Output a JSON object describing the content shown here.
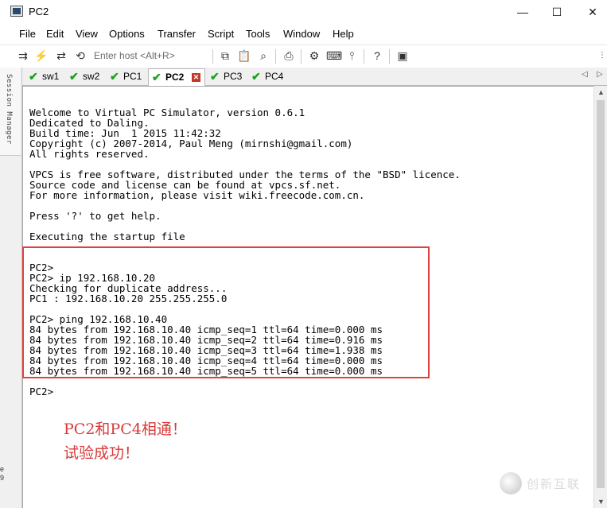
{
  "window": {
    "title": "PC2",
    "controls": [
      "—",
      "☐",
      "✕"
    ]
  },
  "menu": [
    "File",
    "Edit",
    "View",
    "Options",
    "Transfer",
    "Script",
    "Tools",
    "Window",
    "Help"
  ],
  "toolbar": {
    "host_placeholder": "Enter host <Alt+R>",
    "icons": [
      "connect-icon",
      "quick-connect-icon",
      "reconnect-icon",
      "disconnect-icon",
      "copy-icon",
      "paste-icon",
      "find-icon",
      "print-icon",
      "settings-icon",
      "keymap-icon",
      "sftp-icon",
      "help-icon",
      "screenshot-icon"
    ]
  },
  "session_manager": {
    "label": "Session Manager"
  },
  "tabs": [
    {
      "label": "sw1",
      "status": "connected",
      "active": false
    },
    {
      "label": "sw2",
      "status": "connected",
      "active": false
    },
    {
      "label": "PC1",
      "status": "connected",
      "active": false
    },
    {
      "label": "PC2",
      "status": "connected",
      "active": true
    },
    {
      "label": "PC3",
      "status": "connected",
      "active": false
    },
    {
      "label": "PC4",
      "status": "connected",
      "active": false
    }
  ],
  "terminal": {
    "lines": [
      "",
      "Welcome to Virtual PC Simulator, version 0.6.1",
      "Dedicated to Daling.",
      "Build time: Jun  1 2015 11:42:32",
      "Copyright (c) 2007-2014, Paul Meng (mirnshi@gmail.com)",
      "All rights reserved.",
      "",
      "VPCS is free software, distributed under the terms of the \"BSD\" licence.",
      "Source code and license can be found at vpcs.sf.net.",
      "For more information, please visit wiki.freecode.com.cn.",
      "",
      "Press '?' to get help.",
      "",
      "Executing the startup file",
      "",
      "",
      "PC2>",
      "PC2> ip 192.168.10.20",
      "Checking for duplicate address...",
      "PC1 : 192.168.10.20 255.255.255.0",
      "",
      "PC2> ping 192.168.10.40",
      "84 bytes from 192.168.10.40 icmp_seq=1 ttl=64 time=0.000 ms",
      "84 bytes from 192.168.10.40 icmp_seq=2 ttl=64 time=0.916 ms",
      "84 bytes from 192.168.10.40 icmp_seq=3 ttl=64 time=1.938 ms",
      "84 bytes from 192.168.10.40 icmp_seq=4 ttl=64 time=0.000 ms",
      "84 bytes from 192.168.10.40 icmp_seq=5 ttl=64 time=0.000 ms",
      "",
      "PC2>"
    ]
  },
  "annotation": {
    "line1": "PC2和PC4相通！",
    "line2": "试验成功！",
    "color": "#d83a3a"
  },
  "watermark": {
    "text": "创新互联"
  },
  "edge_chars": [
    "e",
    "9"
  ]
}
